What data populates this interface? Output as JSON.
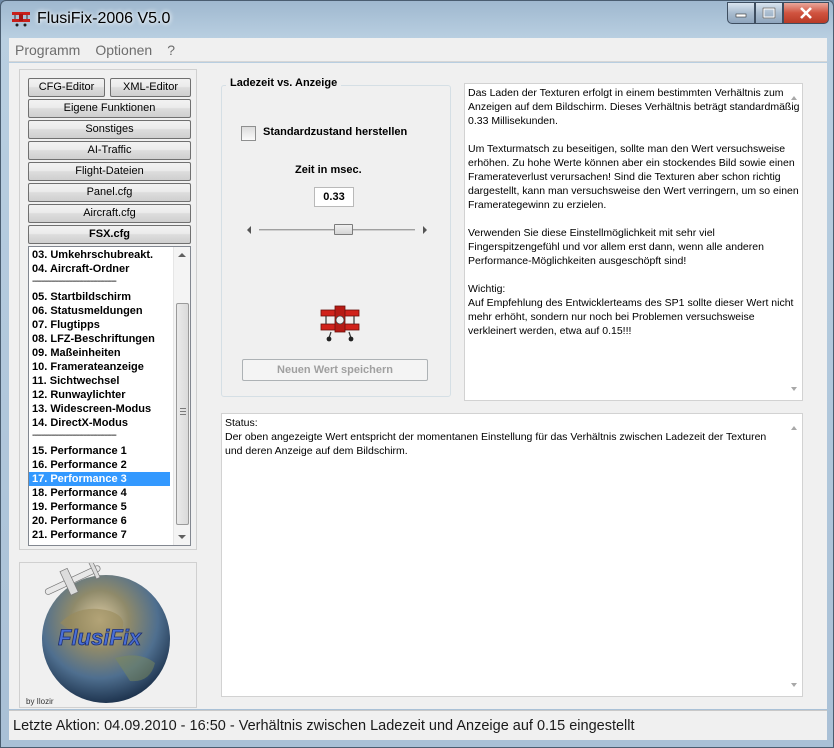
{
  "window": {
    "title": "FlusiFix-2006  V5.0"
  },
  "menu": [
    "Programm",
    "Optionen",
    "?"
  ],
  "left_buttons": {
    "cfg_editor": "CFG-Editor",
    "xml_editor": "XML-Editor",
    "items": [
      {
        "label": "Eigene Funktionen",
        "bold": false
      },
      {
        "label": "Sonstiges",
        "bold": false
      },
      {
        "label": "AI-Traffic",
        "bold": false
      },
      {
        "label": "Flight-Dateien",
        "bold": false
      },
      {
        "label": "Panel.cfg",
        "bold": false
      },
      {
        "label": "Aircraft.cfg",
        "bold": false
      },
      {
        "label": "FSX.cfg",
        "bold": true
      }
    ]
  },
  "list": {
    "items": [
      "03. Umkehrschubreakt.",
      "04. Aircraft-Ordner",
      "------------------------------------",
      "05. Startbildschirm",
      "06. Statusmeldungen",
      "07. Flugtipps",
      "08. LFZ-Beschriftungen",
      "09. Maßeinheiten",
      "10. Framerateanzeige",
      "11. Sichtwechsel",
      "12. Runwaylichter",
      "13. Widescreen-Modus",
      "14. DirectX-Modus",
      "------------------------------------",
      "15. Performance 1",
      "16. Performance 2",
      "17. Performance 3",
      "18. Performance 4",
      "19. Performance 5",
      "20. Performance 6",
      "21. Performance 7"
    ],
    "selected_index": 16,
    "scroll_position": 0.6
  },
  "logo": {
    "text": "FlusiFix",
    "byline": "by Ilozir"
  },
  "settings": {
    "group_title": "Ladezeit vs. Anzeige",
    "checkbox_label": "Standardzustand herstellen",
    "zeit_label": "Zeit in msec.",
    "value": "0.33",
    "slider_position": 0.55,
    "save_button": "Neuen Wert speichern"
  },
  "info": {
    "paragraphs": [
      "Das Laden der Texturen erfolgt in einem bestimmten Verhältnis zum Anzeigen auf dem Bildschirm. Dieses Verhältnis beträgt standardmäßig 0.33 Millisekunden.",
      "Um Texturmatsch zu beseitigen, sollte man den Wert versuchsweise erhöhen. Zu hohe Werte können aber ein stockendes Bild sowie einen Framerateverlust verursachen! Sind die Texturen aber schon richtig dargestellt, kann man versuchsweise den Wert verringern, um so einen Framerategewinn zu erzielen.",
      "Verwenden Sie diese Einstellmöglichkeit mit sehr viel Fingerspitzengefühl und vor allem erst dann, wenn alle anderen Performance-Möglichkeiten ausgeschöpft sind!",
      "Wichtig:\nAuf Empfehlung des Entwicklerteams des SP1 sollte dieser Wert nicht mehr erhöht, sondern nur noch bei Problemen versuchsweise verkleinert werden, etwa auf 0.15!!!"
    ]
  },
  "status": {
    "heading": "Status:",
    "text": "Der oben angezeigte Wert entspricht der momentanen Einstellung für das Verhältnis zwischen Ladezeit der Texturen und deren Anzeige auf dem Bildschirm."
  },
  "statusbar": {
    "text": "Letzte Aktion: 04.09.2010 - 16:50 - Verhältnis zwischen Ladezeit und Anzeige auf 0.15 eingestellt"
  },
  "colors": {
    "selection": "#3399ff",
    "titlebar": "#a9c0d6",
    "close_button": "#c8422e"
  }
}
